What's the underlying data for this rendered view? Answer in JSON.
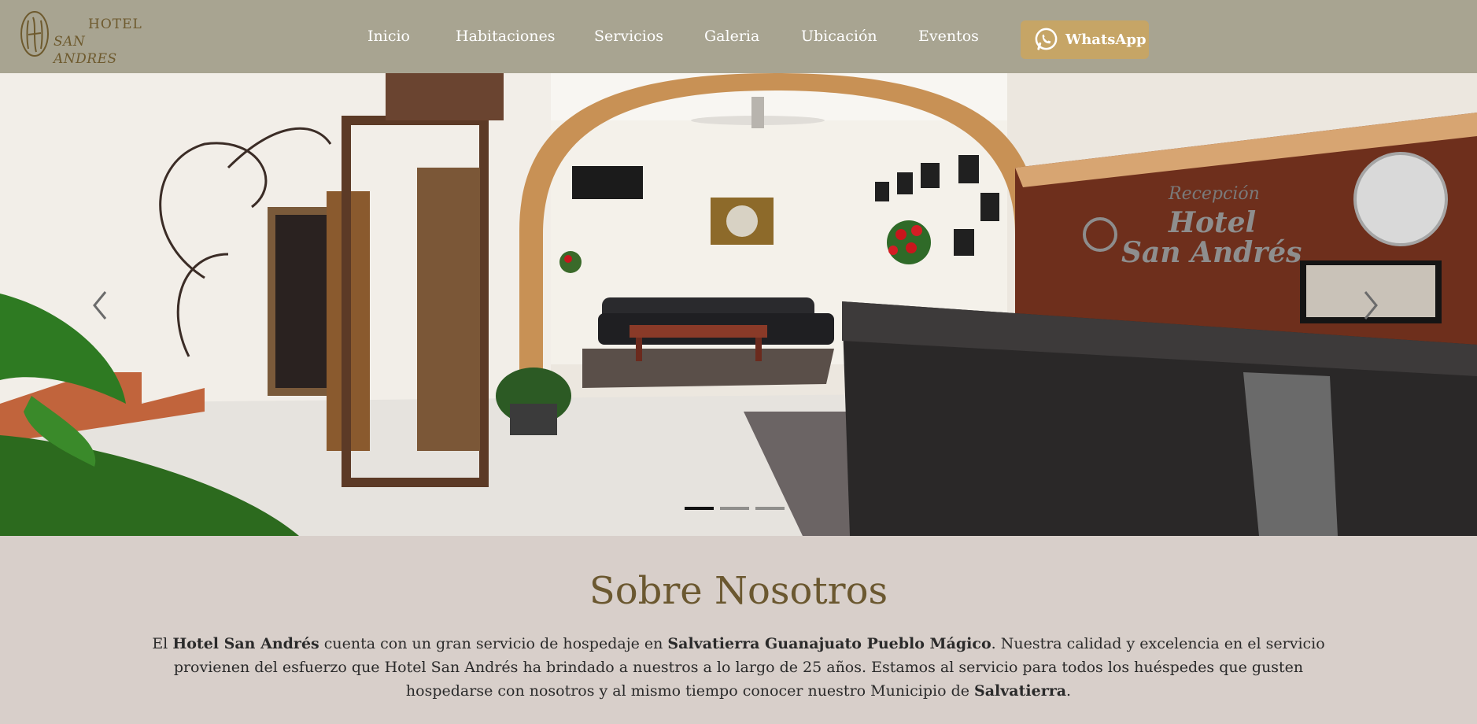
{
  "brand": {
    "line1": "HOTEL",
    "line2": "SAN ANDRES"
  },
  "nav": [
    {
      "label": "Inicio"
    },
    {
      "label": "Habitaciones"
    },
    {
      "label": "Servicios"
    },
    {
      "label": "Galeria"
    },
    {
      "label": "Ubicación"
    },
    {
      "label": "Eventos"
    }
  ],
  "whatsapp": {
    "label": "WhatsApp",
    "icon": "whatsapp-icon"
  },
  "carousel": {
    "slides": 3,
    "active_slide": 1,
    "controls": {
      "prev_icon": "chevron-left-icon",
      "next_icon": "chevron-right-icon"
    },
    "sign_text": {
      "script": "Recepción",
      "line1": "Hotel",
      "line2": "San Andrés"
    }
  },
  "about": {
    "title": "Sobre Nosotros",
    "p1": {
      "t1": "El ",
      "b1": "Hotel San Andrés",
      "t2": " cuenta con un gran servicio de hospedaje en ",
      "b2": "Salvatierra Guanajuato Pueblo Mágico",
      "t3": ". Nuestra calidad y excelencia en el servicio provienen del esfuerzo que Hotel San Andrés ha brindado a nuestros a lo largo de 25 años. Estamos al servicio para todos los huéspedes que gusten hospedarse con nosotros y al mismo tiempo conocer nuestro Municipio de ",
      "b3": "Salvatierra",
      "t4": "."
    }
  },
  "colors": {
    "navbar": "#a8a491",
    "whatsapp_button": "#c6a566",
    "page_background": "#d8cfca",
    "title": "#6b5830"
  }
}
